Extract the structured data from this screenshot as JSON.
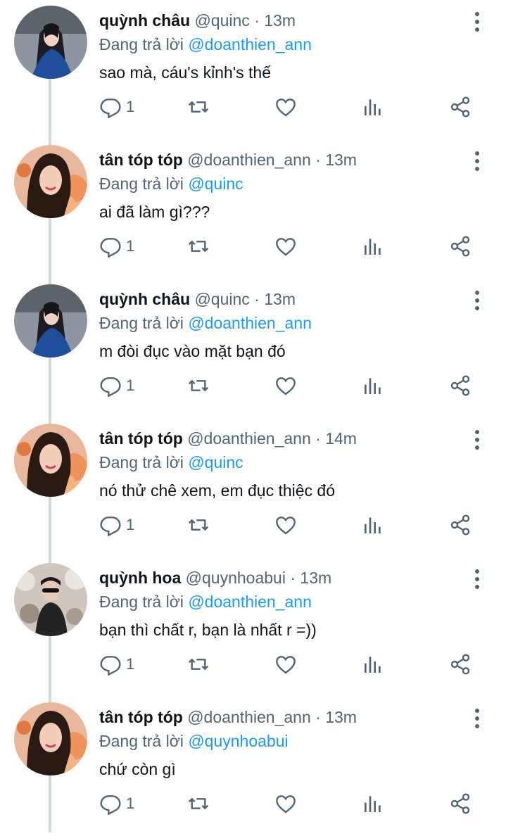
{
  "ui": {
    "reply_prefix": "Đang trả lời",
    "dot": "·"
  },
  "tweets": [
    {
      "name": "quỳnh châu",
      "handle": "@quinc",
      "time": "13m",
      "reply_to": "@doanthien_ann",
      "text": "sao mà, cáu's kỉnh's thế",
      "reply_count": "1",
      "avatar": "avatar-quinc"
    },
    {
      "name": "tân tóp tóp",
      "handle": "@doanthien_ann",
      "time": "13m",
      "reply_to": "@quinc",
      "text": "ai đã làm gì???",
      "reply_count": "1",
      "avatar": "avatar-doanthien"
    },
    {
      "name": "quỳnh châu",
      "handle": "@quinc",
      "time": "13m",
      "reply_to": "@doanthien_ann",
      "text": "m đòi đục vào mặt bạn đó",
      "reply_count": "1",
      "avatar": "avatar-quinc"
    },
    {
      "name": "tân tóp tóp",
      "handle": "@doanthien_ann",
      "time": "14m",
      "reply_to": "@quinc",
      "text": "nó thử chê xem, em đục thiệc đó",
      "reply_count": "1",
      "avatar": "avatar-doanthien"
    },
    {
      "name": "quỳnh hoa",
      "handle": "@quynhoabui",
      "time": "13m",
      "reply_to": "@doanthien_ann",
      "text": "bạn thì chất r, bạn là nhất r =))",
      "reply_count": "1",
      "avatar": "avatar-quynhoa"
    },
    {
      "name": "tân tóp tóp",
      "handle": "@doanthien_ann",
      "time": "13m",
      "reply_to": "@quynhoabui",
      "text": "chứ còn gì",
      "reply_count": "1",
      "avatar": "avatar-doanthien"
    }
  ],
  "colors": {
    "text": "#0f1419",
    "secondary": "#536471",
    "accent": "#1d9bf0",
    "thread_line": "#cfd9de"
  }
}
